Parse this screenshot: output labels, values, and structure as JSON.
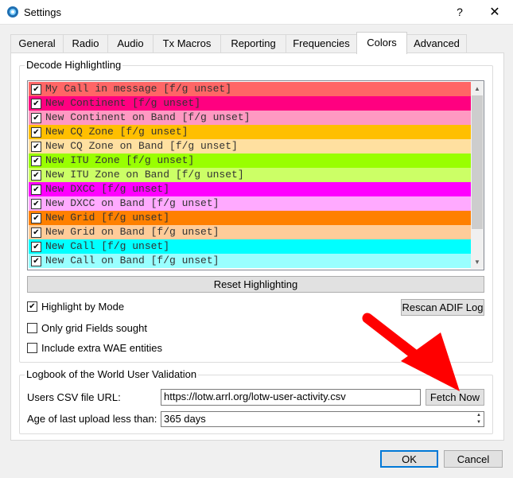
{
  "window": {
    "title": "Settings",
    "help_glyph": "?",
    "close_glyph": "✕"
  },
  "tabs": [
    {
      "label": "General"
    },
    {
      "label": "Radio"
    },
    {
      "label": "Audio"
    },
    {
      "label": "Tx Macros"
    },
    {
      "label": "Reporting"
    },
    {
      "label": "Frequencies"
    },
    {
      "label": "Colors",
      "active": true
    },
    {
      "label": "Advanced"
    }
  ],
  "decode": {
    "title": "Decode Highlightling",
    "items": [
      {
        "label": "My Call in message [f/g unset]",
        "color": "#ff6666",
        "checked": true
      },
      {
        "label": "New Continent [f/g unset]",
        "color": "#ff0080",
        "checked": true
      },
      {
        "label": "New Continent on Band [f/g unset]",
        "color": "#ff99c2",
        "checked": true
      },
      {
        "label": "New CQ Zone [f/g unset]",
        "color": "#ffbf00",
        "checked": true
      },
      {
        "label": "New CQ Zone on Band [f/g unset]",
        "color": "#ffe0a0",
        "checked": true
      },
      {
        "label": "New ITU Zone [f/g unset]",
        "color": "#99ff00",
        "checked": true
      },
      {
        "label": "New ITU Zone on Band [f/g unset]",
        "color": "#ccff66",
        "checked": true
      },
      {
        "label": "New DXCC [f/g unset]",
        "color": "#ff00ff",
        "checked": true
      },
      {
        "label": "New DXCC on Band [f/g unset]",
        "color": "#ffaaff",
        "checked": true
      },
      {
        "label": "New Grid [f/g unset]",
        "color": "#ff8000",
        "checked": true
      },
      {
        "label": "New Grid on Band [f/g unset]",
        "color": "#ffcc99",
        "checked": true
      },
      {
        "label": "New Call [f/g unset]",
        "color": "#00ffff",
        "checked": true
      },
      {
        "label": "New Call on Band [f/g unset]",
        "color": "#99ffff",
        "checked": true
      }
    ],
    "check_glyph": "✔",
    "reset_label": "Reset Highlighting",
    "rescan_label": "Rescan ADIF Log",
    "options": [
      {
        "label": "Highlight by Mode",
        "checked": true
      },
      {
        "label": "Only grid Fields sought",
        "checked": false
      },
      {
        "label": "Include extra WAE entities",
        "checked": false
      }
    ]
  },
  "lotw": {
    "title": "Logbook of the World User Validation",
    "url_label": "Users CSV file URL:",
    "url_value": "https://lotw.arrl.org/lotw-user-activity.csv",
    "fetch_label": "Fetch Now",
    "age_label": "Age of last upload less than:",
    "age_value": "365 days"
  },
  "footer": {
    "ok_label": "OK",
    "cancel_label": "Cancel"
  },
  "annotation": {
    "arrow_color": "#ff0000"
  }
}
